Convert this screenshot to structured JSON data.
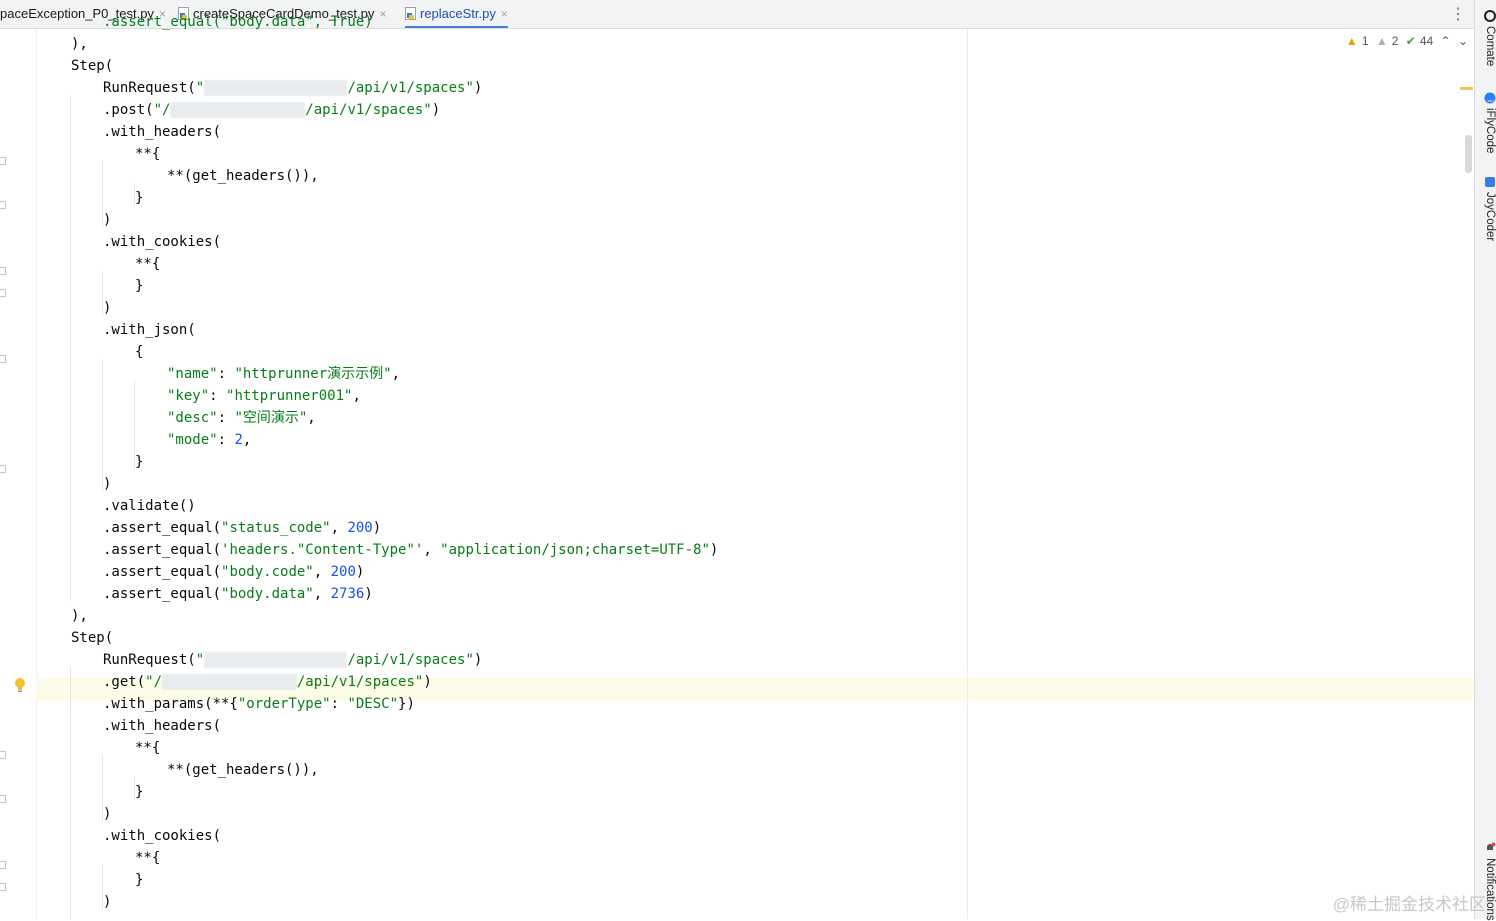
{
  "tabs": [
    {
      "label": "paceException_P0_test.py",
      "active": false
    },
    {
      "label": "createSpaceCardDemo_test.py",
      "active": false
    },
    {
      "label": "replaceStr.py",
      "active": true
    }
  ],
  "tab_close_glyph": "×",
  "tab_menu_glyph": "⋮",
  "inspections": {
    "warnings": "1",
    "weak_warnings": "2",
    "typos": "44"
  },
  "right_tools": [
    "Comate",
    "iFlyCode",
    "JoyCoder",
    "Notifications"
  ],
  "watermark": "@稀土掘金技术社区",
  "code": {
    "l0": ".assert_equal(\"body.data\", True)",
    "l1": "),",
    "l2": "Step(",
    "l3_a": "RunRequest(\"",
    "l3_b": "/api/v1/spaces\")",
    "l4_a": ".post(\"/",
    "l4_b": "/api/v1/spaces\")",
    "l5": ".with_headers(",
    "l6": "**{",
    "l7": "**(get_headers()),",
    "l8": "}",
    "l9": ")",
    "l10": ".with_cookies(",
    "l11": "**{",
    "l12": "}",
    "l13": ")",
    "l14": ".with_json(",
    "l15": "{",
    "l16_k": "\"name\"",
    "l16_v": "\"httprunner演示示例\"",
    "l17_k": "\"key\"",
    "l17_v": "\"httprunner001\"",
    "l18_k": "\"desc\"",
    "l18_v": "\"空间演示\"",
    "l19_k": "\"mode\"",
    "l19_v": "2",
    "l20": "}",
    "l21": ")",
    "l22": ".validate()",
    "l23_k": "\"status_code\"",
    "l23_v": "200",
    "l24_k": "'headers.\"Content-Type\"'",
    "l24_v": "\"application/json;charset=UTF-8\"",
    "l25_k": "\"body.code\"",
    "l25_v": "200",
    "l26_k": "\"body.data\"",
    "l26_v": "2736",
    "l27": "),",
    "l28": "Step(",
    "l29_a": "RunRequest(\"",
    "l29_b": "/api/v1/spaces\")",
    "l30_a": ".get(\"/",
    "l30_b": "/api/v1/spaces\")",
    "l31_k": "\"orderType\"",
    "l31_v": "\"DESC\"",
    "l32": ".with_headers(",
    "l33": "**{",
    "l34": "**(get_headers()),",
    "l35": "}",
    "l36": ")",
    "l37": ".with_cookies(",
    "l38": "**{",
    "l39": "}",
    "l40": ")"
  }
}
